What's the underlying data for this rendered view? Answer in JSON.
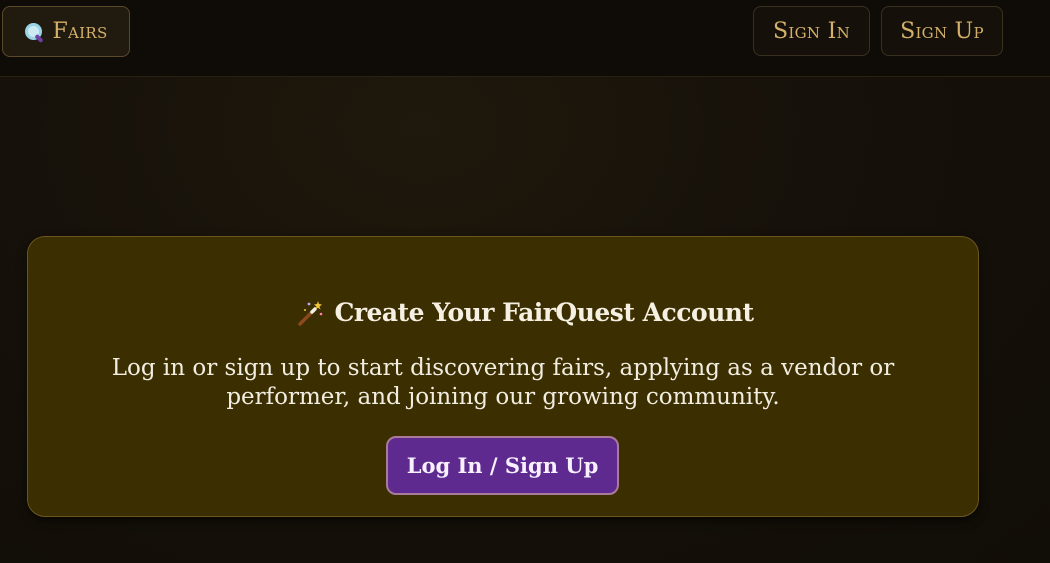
{
  "nav": {
    "fairs_label": "Fairs",
    "signin_label": "Sign In",
    "signup_label": "Sign Up",
    "fairs_icon": "magnifier-icon"
  },
  "card": {
    "icon": "magic-wand-icon",
    "title": "Create Your FairQuest Account",
    "description": "Log in or sign up to start discovering fairs, applying as a vendor or performer, and joining our growing community.",
    "cta_label": "Log In / Sign Up"
  },
  "colors": {
    "accent_gold": "#d4b06a",
    "card_bg": "#3b2e00",
    "cta_purple": "#5f2a8f",
    "page_bg": "#120e08"
  }
}
